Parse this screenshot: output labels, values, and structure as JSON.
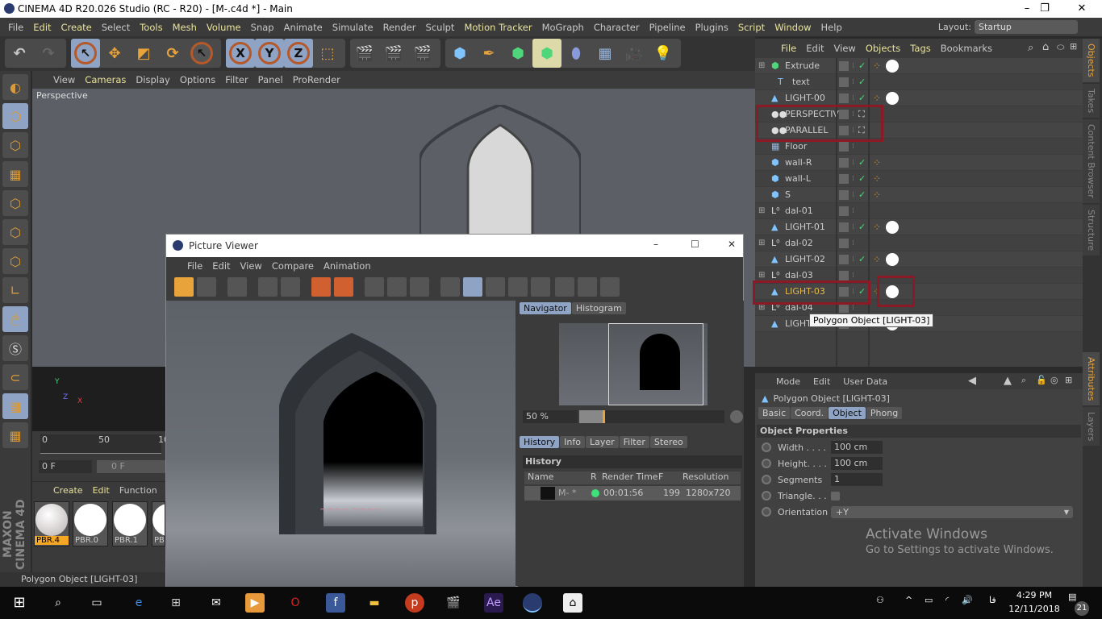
{
  "window": {
    "title": "CINEMA 4D R20.026 Studio (RC - R20) - [M-.c4d *] - Main",
    "minimize": "–",
    "maximize": "❐",
    "close": "✕"
  },
  "menu": [
    {
      "label": "File",
      "hl": false
    },
    {
      "label": "Edit",
      "hl": true
    },
    {
      "label": "Create",
      "hl": true
    },
    {
      "label": "Select",
      "hl": false
    },
    {
      "label": "Tools",
      "hl": true
    },
    {
      "label": "Mesh",
      "hl": true
    },
    {
      "label": "Volume",
      "hl": true
    },
    {
      "label": "Snap",
      "hl": false
    },
    {
      "label": "Animate",
      "hl": false
    },
    {
      "label": "Simulate",
      "hl": false
    },
    {
      "label": "Render",
      "hl": false
    },
    {
      "label": "Sculpt",
      "hl": false
    },
    {
      "label": "Motion Tracker",
      "hl": true
    },
    {
      "label": "MoGraph",
      "hl": false
    },
    {
      "label": "Character",
      "hl": false
    },
    {
      "label": "Pipeline",
      "hl": false
    },
    {
      "label": "Plugins",
      "hl": false
    },
    {
      "label": "Script",
      "hl": true
    },
    {
      "label": "Window",
      "hl": true
    },
    {
      "label": "Help",
      "hl": false
    }
  ],
  "layout": {
    "label": "Layout:",
    "value": "Startup"
  },
  "axis_buttons": [
    "X",
    "Y",
    "Z"
  ],
  "viewport": {
    "menu": [
      "View",
      "Cameras",
      "Display",
      "Options",
      "Filter",
      "Panel",
      "ProRender"
    ],
    "label": "Perspective"
  },
  "timeline": {
    "ticks": [
      "0",
      "50",
      "10"
    ],
    "frame_field": "0 F",
    "frame_field2": "0 F"
  },
  "materials": {
    "menu": [
      "Create",
      "Edit",
      "Function"
    ],
    "items": [
      "PBR.4",
      "PBR.0",
      "PBR.1",
      "PB"
    ]
  },
  "logo": "MAXON CINEMA 4D",
  "statusbar": "Polygon Object [LIGHT-03]",
  "picture_viewer": {
    "title": "Picture Viewer",
    "menu": [
      "File",
      "Edit",
      "View",
      "Compare",
      "Animation"
    ],
    "tabs_top": [
      "Navigator",
      "Histogram"
    ],
    "zoom": "50 %",
    "tabs_bottom": [
      "History",
      "Info",
      "Layer",
      "Filter",
      "Stereo"
    ],
    "history_title": "History",
    "columns": [
      "Name",
      "R",
      "Render Time",
      "F",
      "Resolution"
    ],
    "rows": [
      {
        "name": "M- *",
        "status_color": "#3ee07a",
        "time": "00:01:56",
        "frames": "199",
        "resolution": "1280x720"
      }
    ]
  },
  "object_manager": {
    "menu": [
      {
        "label": "File",
        "hl": true
      },
      {
        "label": "Edit",
        "hl": false
      },
      {
        "label": "View",
        "hl": false
      },
      {
        "label": "Objects",
        "hl": true
      },
      {
        "label": "Tags",
        "hl": true
      },
      {
        "label": "Bookmarks",
        "hl": false
      }
    ],
    "objects": [
      {
        "name": "Extrude",
        "icon": "extrude-icon",
        "check": true,
        "tag": true,
        "material": true
      },
      {
        "name": "text",
        "icon": "text-icon",
        "check": true,
        "tag": false,
        "material": false
      },
      {
        "name": "LIGHT-00",
        "icon": "polygon-icon",
        "check": true,
        "tag": true,
        "material": true
      },
      {
        "name": "PERSPECTIV",
        "icon": "camera-icon",
        "check": false,
        "tag": false,
        "material": false
      },
      {
        "name": "PARALLEL",
        "icon": "camera-icon",
        "check": false,
        "tag": false,
        "material": false
      },
      {
        "name": "Floor",
        "icon": "floor-icon",
        "check": false,
        "tag": false,
        "material": false
      },
      {
        "name": "wall-R",
        "icon": "cube-icon",
        "check": true,
        "tag": true,
        "material": false
      },
      {
        "name": "wall-L",
        "icon": "cube-icon",
        "check": true,
        "tag": true,
        "material": false
      },
      {
        "name": "S",
        "icon": "cube-icon",
        "check": true,
        "tag": true,
        "material": false
      },
      {
        "name": "dal-01",
        "icon": "null-icon",
        "check": false,
        "tag": false,
        "material": false
      },
      {
        "name": "LIGHT-01",
        "icon": "polygon-icon",
        "check": true,
        "tag": true,
        "material": true
      },
      {
        "name": "dal-02",
        "icon": "null-icon",
        "check": false,
        "tag": false,
        "material": false
      },
      {
        "name": "LIGHT-02",
        "icon": "polygon-icon",
        "check": true,
        "tag": true,
        "material": true
      },
      {
        "name": "dal-03",
        "icon": "null-icon",
        "check": false,
        "tag": false,
        "material": false
      },
      {
        "name": "LIGHT-03",
        "icon": "polygon-icon",
        "check": true,
        "tag": true,
        "material": true,
        "selected": true
      },
      {
        "name": "dal-04",
        "icon": "null-icon",
        "check": false,
        "tag": false,
        "material": false
      },
      {
        "name": "LIGHT-04",
        "icon": "polygon-icon",
        "check": true,
        "tag": true,
        "material": true
      }
    ],
    "tooltip": "Polygon Object [LIGHT-03]"
  },
  "right_tabs": [
    "Objects",
    "Takes",
    "Content Browser",
    "Structure"
  ],
  "attributes": {
    "menu": [
      "Mode",
      "Edit",
      "User Data"
    ],
    "title": "Polygon Object [LIGHT-03]",
    "tabs": [
      "Basic",
      "Coord.",
      "Object",
      "Phong"
    ],
    "active_tab": "Object",
    "section": "Object Properties",
    "props": [
      {
        "label": "Width . . . .",
        "value": "100 cm"
      },
      {
        "label": "Height. . . .",
        "value": "100 cm"
      },
      {
        "label": "Segments",
        "value": "1"
      }
    ],
    "triangle_label": "Triangle. . .",
    "orientation_label": "Orientation",
    "orientation_value": "+Y"
  },
  "attr_right_tabs": [
    "Attributes",
    "Layers"
  ],
  "activate": {
    "line1": "Activate Windows",
    "line2": "Go to Settings to activate Windows."
  },
  "taskbar": {
    "time": "4:29 PM",
    "date": "12/11/2018",
    "lang": "فا",
    "notifications": "21"
  },
  "colors": {
    "accent": "#8fa3c4",
    "highlight_menu": "#e9e39b",
    "selected_object": "#e6b94a",
    "annotation_box": "#8b1a26"
  }
}
